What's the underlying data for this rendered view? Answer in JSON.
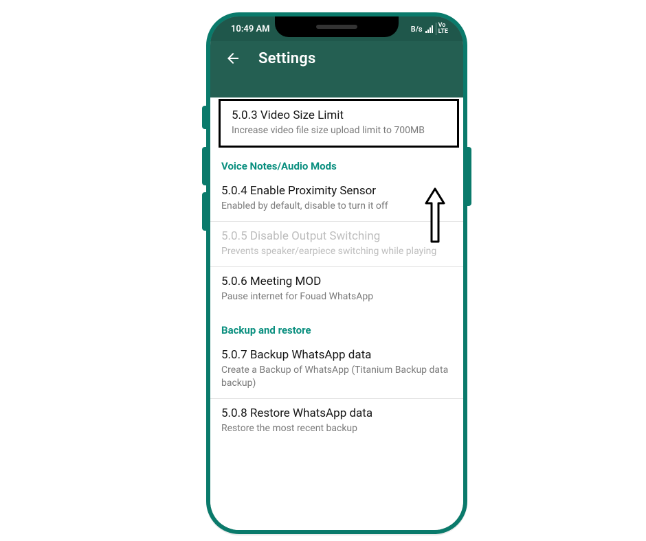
{
  "statusbar": {
    "time": "10:49 AM",
    "net_speed_fragment": "B/s",
    "lte_label_top": "Vo",
    "lte_label_bot": "LTE"
  },
  "header": {
    "title": "Settings"
  },
  "items": {
    "video_size": {
      "title": "5.0.3 Video Size Limit",
      "sub": "Increase video file size upload limit to 700MB"
    },
    "proximity": {
      "title": "5.0.4 Enable Proximity Sensor",
      "sub": "Enabled by default, disable to turn it off"
    },
    "output_switch": {
      "title": "5.0.5 Disable Output Switching",
      "sub": "Prevents speaker/earpiece switching while playing"
    },
    "meeting_mod": {
      "title": "5.0.6 Meeting MOD",
      "sub": "Pause internet for Fouad WhatsApp"
    },
    "backup": {
      "title": "5.0.7 Backup WhatsApp data",
      "sub": "Create a Backup of WhatsApp (Titanium Backup data backup)"
    },
    "restore": {
      "title": "5.0.8 Restore WhatsApp data",
      "sub": "Restore the most recent backup"
    }
  },
  "sections": {
    "voice": "Voice Notes/Audio Mods",
    "backup": "Backup and restore"
  }
}
